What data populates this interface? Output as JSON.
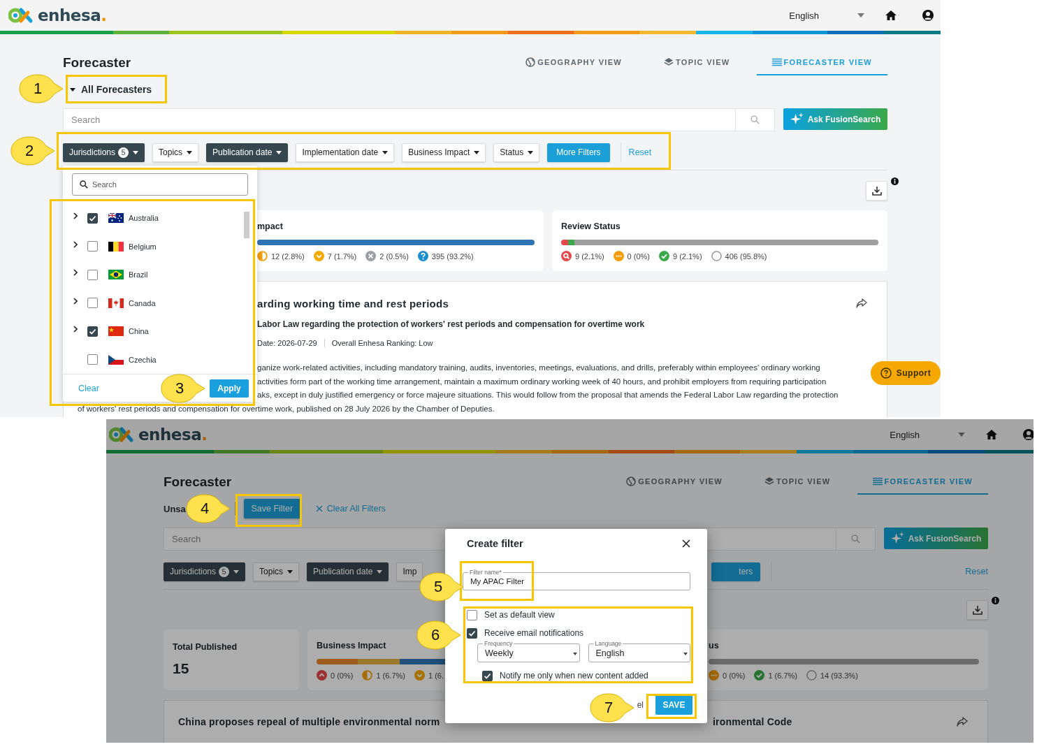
{
  "top": {
    "header": {
      "logo": {
        "text": "enhesa",
        "dot": "."
      },
      "language": "English"
    },
    "title": "Forecaster",
    "tabs": [
      {
        "label": "GEOGRAPHY VIEW",
        "selected": false
      },
      {
        "label": "TOPIC VIEW",
        "selected": false
      },
      {
        "label": "FORECASTER VIEW",
        "selected": true
      }
    ],
    "forecaster_menu": "All Forecasters",
    "search": {
      "placeholder": "Search"
    },
    "ask_button": "Ask FusionSearch",
    "filters": [
      {
        "kind": "dropdown",
        "label": "Jurisdictions",
        "count": "5",
        "active": true,
        "caret": true
      },
      {
        "kind": "dropdown",
        "label": "Topics",
        "active": false,
        "caret": true
      },
      {
        "kind": "dropdown",
        "label": "Publication date",
        "active": true,
        "caret": true
      },
      {
        "kind": "dropdown",
        "label": "Implementation date",
        "active": false,
        "caret": true
      },
      {
        "kind": "dropdown",
        "label": "Business Impact",
        "active": false,
        "caret": true
      },
      {
        "kind": "dropdown",
        "label": "Status",
        "active": false,
        "caret": true
      },
      {
        "kind": "more",
        "label": "More Filters"
      }
    ],
    "reset": "Reset",
    "cards": [
      {
        "kind": "bars",
        "title": "mpact",
        "segments": [
          {
            "color": "#2f75b5",
            "level": 1
          }
        ],
        "stats": [
          {
            "kind": "half",
            "text": "12 (2.8%)"
          },
          {
            "kind": "down",
            "text": "7 (1.7%)"
          },
          {
            "kind": "none",
            "text": "2 (0.5%)"
          },
          {
            "kind": "unknown",
            "text": "395 (93.2%)"
          }
        ]
      },
      {
        "kind": "bars",
        "title": "Review Status",
        "segments": [
          {
            "color": "#e5484d",
            "level": 0.021
          },
          {
            "color": "#3aaa4a",
            "level": 0.021
          },
          {
            "color": "#9e9e9e",
            "level": 0.958
          }
        ],
        "stats": [
          {
            "kind": "review",
            "text": "9 (2.1%)"
          },
          {
            "kind": "pending",
            "text": "0 (0%)"
          },
          {
            "kind": "done",
            "text": "9 (2.1%)"
          },
          {
            "kind": "open",
            "text": "406 (95.8%)"
          }
        ]
      }
    ],
    "article": {
      "title": "arding working time and rest periods",
      "subtitle": "Labor Law regarding the protection of workers' rest periods and compensation for overtime work",
      "meta": [
        "Date: 2026-07-29",
        "Overall Enhesa Ranking: Low"
      ],
      "line_parts": [
        "ganize work-related activities, including mandatory training, audits, inventories, meetings, evaluations, and drills, preferably within employees' ordinary working",
        "activities form part of the working time arrangement, maintain a maximum ordinary working week of 40 hours, and prohibit employers from requiring participation",
        "aks, except in duly justified emergency or force majeure situations. This would follow from the proposal that amends the Federal Labor Law regarding the protection"
      ],
      "last_line": "of workers' rest periods and compensation for overtime work, published on 28 July 2026 by the Chamber of Deputies."
    },
    "support": "Support",
    "jurisdiction_dropdown": {
      "search_placeholder": "Search",
      "countries": [
        {
          "name": "Australia",
          "checked": true,
          "expandable": true
        },
        {
          "name": "Belgium",
          "checked": false,
          "expandable": true
        },
        {
          "name": "Brazil",
          "checked": false,
          "expandable": true
        },
        {
          "name": "Canada",
          "checked": false,
          "expandable": true
        },
        {
          "name": "China",
          "checked": true,
          "expandable": true
        },
        {
          "name": "Czechia",
          "checked": false,
          "expandable": false
        }
      ],
      "clear": "Clear",
      "apply": "Apply"
    }
  },
  "bottom": {
    "header": {
      "logo": {
        "text": "enhesa",
        "dot": "."
      },
      "language": "English"
    },
    "title": "Forecaster",
    "tabs": [
      {
        "label": "GEOGRAPHY VIEW",
        "selected": false
      },
      {
        "label": "TOPIC VIEW",
        "selected": false
      },
      {
        "label": "FORECASTER VIEW",
        "selected": true
      }
    ],
    "saved_view": "Unsa",
    "save_filter": "Save Filter",
    "clear_all": "Clear All Filters",
    "search": {
      "placeholder": "Search"
    },
    "ask_button": "Ask FusionSearch",
    "filters": [
      {
        "kind": "dropdown",
        "label": "Jurisdictions",
        "count": "5",
        "active": true,
        "caret": true
      },
      {
        "kind": "dropdown",
        "label": "Topics",
        "active": false,
        "caret": true
      },
      {
        "kind": "dropdown",
        "label": "Publication date",
        "active": true,
        "caret": true
      },
      {
        "kind": "dropdown",
        "label": "Imp",
        "active": false,
        "caret": false
      },
      {
        "kind": "more",
        "label": "ters"
      }
    ],
    "reset": "Reset",
    "cards": [
      {
        "kind": "total",
        "title": "Total Published",
        "value": "15"
      },
      {
        "kind": "bars",
        "title": "Business Impact",
        "segments": [
          {
            "kind": "high",
            "level": 0.13
          },
          {
            "kind": "medium",
            "level": 0.13
          },
          {
            "kind": "unknown",
            "level": 0.74
          }
        ],
        "stats": [
          {
            "kind": "up",
            "text": "0 (0%)"
          },
          {
            "kind": "half",
            "text": "1 (6.7%)"
          },
          {
            "kind": "down",
            "text": "1 (6."
          }
        ]
      },
      {
        "kind": "bars",
        "title": "us",
        "segments": [
          {
            "kind": "open",
            "level": 1
          }
        ],
        "stats": [
          {
            "kind": "pending",
            "text": "0 (0%)"
          },
          {
            "kind": "done",
            "text": "1 (6.7%)"
          },
          {
            "kind": "open",
            "text": "14 (93.3%)"
          }
        ]
      }
    ],
    "article": {
      "title_left": "China proposes repeal of multiple environmental norm",
      "title_right": "ironmental Code"
    },
    "modal": {
      "title": "Create filter",
      "name_field": {
        "label": "Filter name*",
        "value": "My APAC Filter"
      },
      "options": [
        {
          "label": "Set as default view",
          "checked": false
        },
        {
          "label": "Receive email notifications",
          "checked": true
        }
      ],
      "frequency": {
        "label": "Frequency",
        "value": "Weekly"
      },
      "language": {
        "label": "Language",
        "value": "English"
      },
      "notify": {
        "label": "Notify me only when new content added",
        "checked": true
      },
      "cancel": "el",
      "save": "SAVE"
    }
  },
  "callouts": [
    {
      "number": "1"
    },
    {
      "number": "2"
    },
    {
      "number": "3"
    },
    {
      "number": "4"
    },
    {
      "number": "5"
    },
    {
      "number": "6"
    },
    {
      "number": "7"
    }
  ]
}
